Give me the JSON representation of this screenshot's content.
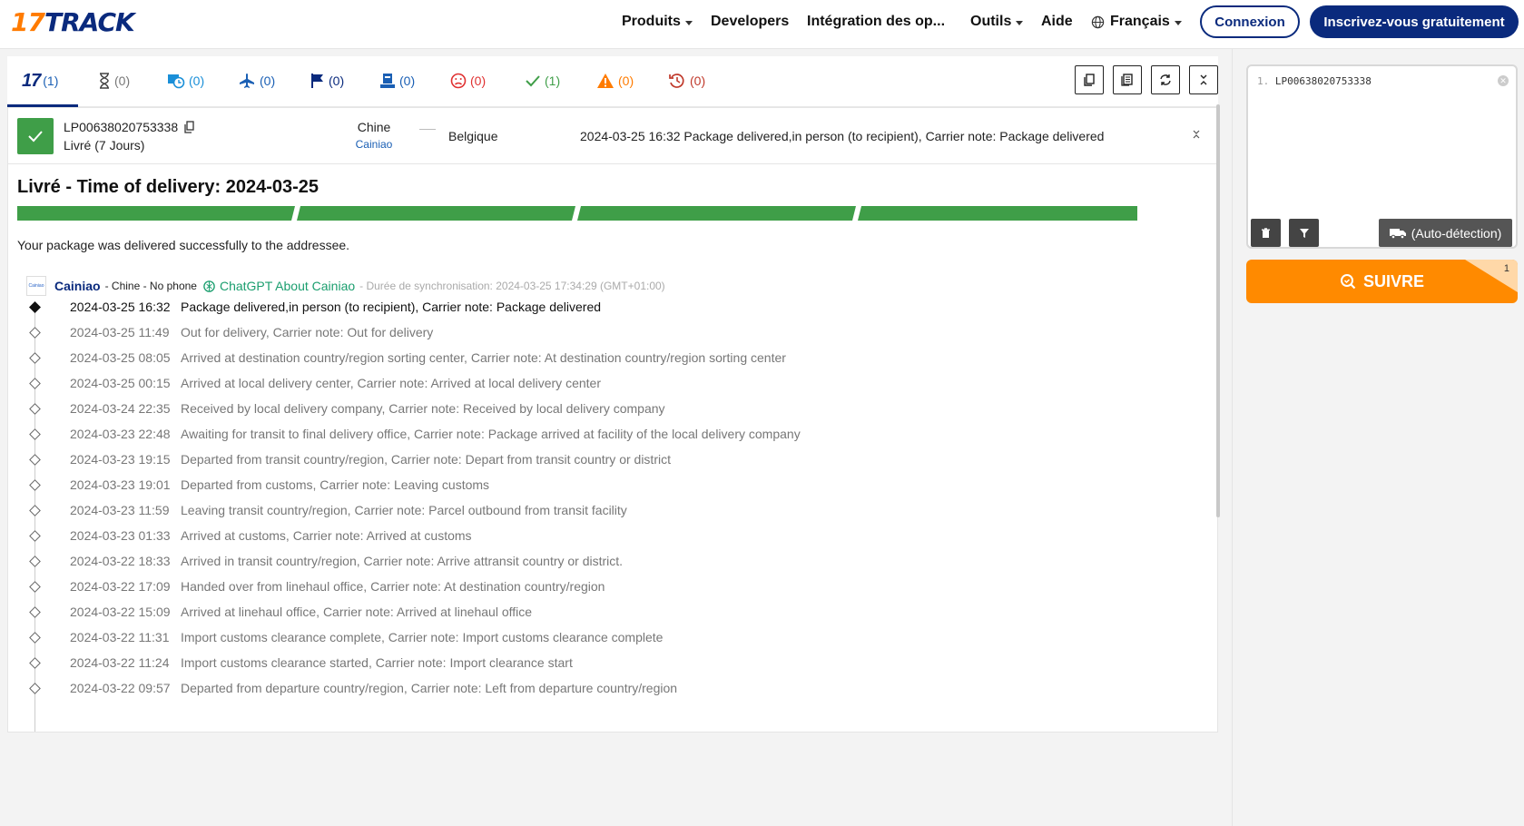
{
  "header": {
    "logo_text": "17TRACK",
    "logo_num": "17",
    "logo_rest": "TRACK",
    "nav": [
      {
        "label": "Produits",
        "has_caret": true
      },
      {
        "label": "Developers",
        "has_caret": false
      },
      {
        "label": "Intégration des op...",
        "has_caret": false
      },
      {
        "label": "Outils",
        "has_caret": true
      },
      {
        "label": "Aide",
        "has_caret": false
      },
      {
        "label": "Français",
        "has_caret": true,
        "icon": "globe-icon"
      }
    ],
    "login_label": "Connexion",
    "signup_label": "Inscrivez-vous gratuitement"
  },
  "status_tabs": [
    {
      "icon": "all-17-icon",
      "count": "(1)",
      "color": "#1a5fb4"
    },
    {
      "icon": "hourglass-icon",
      "count": "(0)",
      "color": "#777777"
    },
    {
      "icon": "in-transit-clock-icon",
      "count": "(0)",
      "color": "#1a8fd8"
    },
    {
      "icon": "airplane-icon",
      "count": "(0)",
      "color": "#1a5fb4"
    },
    {
      "icon": "flag-icon",
      "count": "(0)",
      "color": "#0a2a7d"
    },
    {
      "icon": "pickup-icon",
      "count": "(0)",
      "color": "#1a5fb4"
    },
    {
      "icon": "sad-face-icon",
      "count": "(0)",
      "color": "#e03131"
    },
    {
      "icon": "checkmark-icon",
      "count": "(1)",
      "color": "#3f9e48"
    },
    {
      "icon": "warning-icon",
      "count": "(0)",
      "color": "#ff7b00"
    },
    {
      "icon": "expired-clock-icon",
      "count": "(0)",
      "color": "#c0392b"
    }
  ],
  "shipment": {
    "tracking_number": "LP00638020753338",
    "status": "Livré (7 Jours)",
    "origin": "Chine",
    "carrier": "Cainiao",
    "destination": "Belgique",
    "latest_event": "2024-03-25 16:32  Package delivered,in person (to recipient), Carrier note: Package delivered",
    "headline": "Livré - Time of delivery:  2024-03-25",
    "progress_fraction": 1.0,
    "description": "Your package was delivered successfully to the addressee.",
    "carrier_logo_text": "Cainiao",
    "carrier_name": "Cainiao",
    "carrier_meta": "- Chine  - No phone",
    "chatgpt_label": "ChatGPT About Cainiao",
    "sync_text": "- Durée de synchronisation: 2024-03-25 17:34:29 (GMT+01:00)"
  },
  "events": [
    {
      "time": "2024-03-25 16:32",
      "desc": "Package delivered,in person (to recipient), Carrier note: Package delivered"
    },
    {
      "time": "2024-03-25 11:49",
      "desc": "Out for delivery, Carrier note: Out for delivery"
    },
    {
      "time": "2024-03-25 08:05",
      "desc": "Arrived at destination country/region sorting center, Carrier note: At destination country/region sorting center"
    },
    {
      "time": "2024-03-25 00:15",
      "desc": "Arrived at local delivery center, Carrier note: Arrived at local delivery center"
    },
    {
      "time": "2024-03-24 22:35",
      "desc": "Received by local delivery company, Carrier note: Received by local delivery company"
    },
    {
      "time": "2024-03-23 22:48",
      "desc": "Awaiting for transit to final delivery office, Carrier note: Package arrived at facility of the local delivery company"
    },
    {
      "time": "2024-03-23 19:15",
      "desc": "Departed from transit country/region, Carrier note: Depart from transit country or district"
    },
    {
      "time": "2024-03-23 19:01",
      "desc": "Departed from customs, Carrier note: Leaving customs"
    },
    {
      "time": "2024-03-23 11:59",
      "desc": "Leaving transit country/region, Carrier note: Parcel outbound from transit facility"
    },
    {
      "time": "2024-03-23 01:33",
      "desc": "Arrived at customs, Carrier note: Arrived at customs"
    },
    {
      "time": "2024-03-22 18:33",
      "desc": "Arrived in transit country/region, Carrier note: Arrive attransit country or district."
    },
    {
      "time": "2024-03-22 17:09",
      "desc": "Handed over from linehaul office, Carrier note: At destination country/region"
    },
    {
      "time": "2024-03-22 15:09",
      "desc": "Arrived at linehaul office, Carrier note: Arrived at linehaul office"
    },
    {
      "time": "2024-03-22 11:31",
      "desc": "Import customs clearance complete, Carrier note: Import customs clearance complete"
    },
    {
      "time": "2024-03-22 11:24",
      "desc": "Import customs clearance started, Carrier note: Import clearance start"
    },
    {
      "time": "2024-03-22 09:57",
      "desc": "Departed from departure country/region, Carrier note: Left from departure country/region"
    }
  ],
  "sidebar": {
    "input_line_number": "1.",
    "input_value": "LP00638020753338",
    "auto_detect_label": "(Auto-détection)",
    "track_label": "SUIVRE",
    "track_badge": "1"
  },
  "colors": {
    "brand_navy": "#0a2a7d",
    "brand_orange": "#ff8a00",
    "delivered_green": "#3f9e48"
  }
}
